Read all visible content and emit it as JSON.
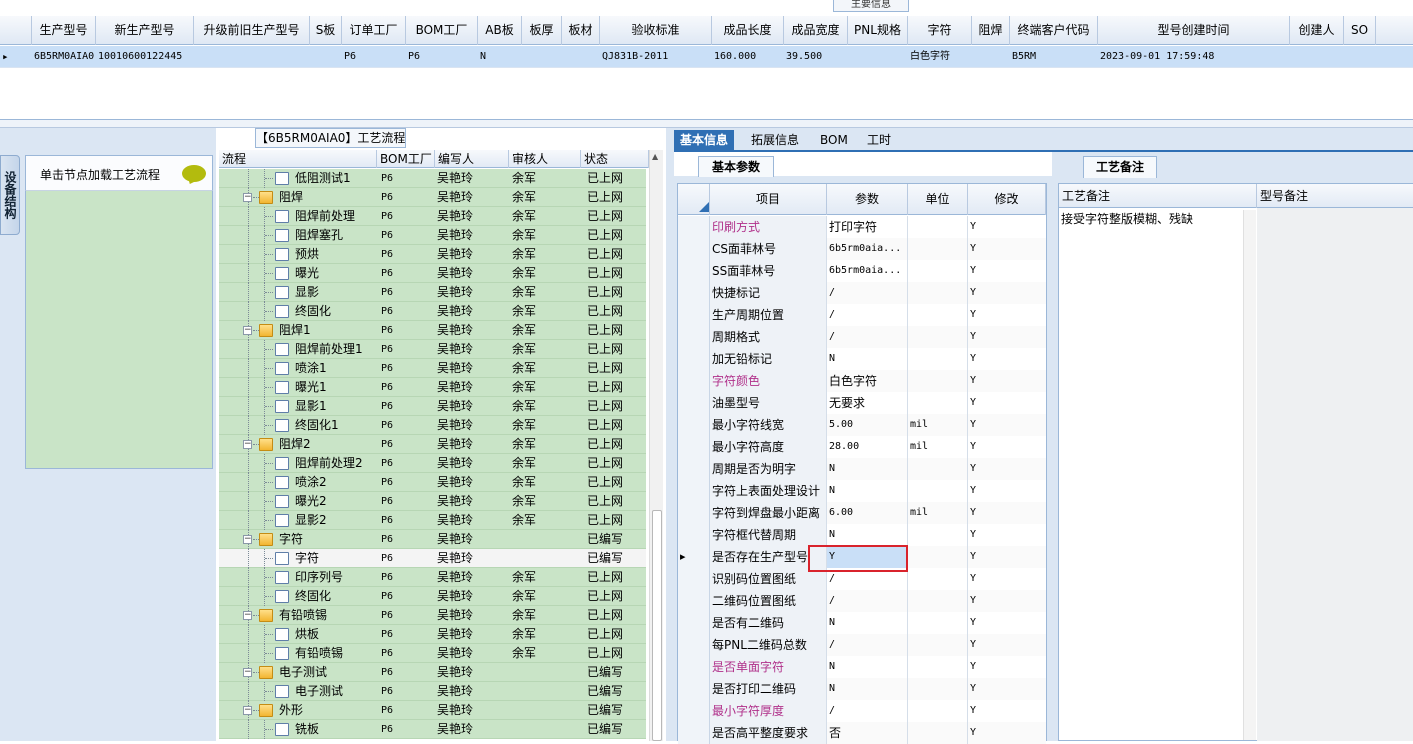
{
  "top_grid": {
    "group_label": "主要信息",
    "columns": [
      "生产型号",
      "新生产型号",
      "升级前旧生产型号",
      "S板",
      "订单工厂",
      "BOM工厂",
      "AB板",
      "板厚",
      "板材",
      "验收标准",
      "成品长度",
      "成品宽度",
      "PNL规格",
      "字符",
      "阻焊",
      "终端客户代码",
      "型号创建时间",
      "创建人",
      "SO"
    ],
    "row": [
      "6B5RM0AIA0",
      "10010600122445",
      "",
      "",
      "P6",
      "P6",
      "N",
      "",
      "",
      "QJ831B-2011",
      "160.000",
      "39.500",
      "",
      "白色字符",
      "",
      "B5RM",
      "2023-09-01 17:59:48",
      "",
      ""
    ]
  },
  "left_nav": {
    "tab_label": "设备结构",
    "hint": "单击节点加载工艺流程"
  },
  "process_tree": {
    "title": "【6B5RM0AIA0】工艺流程",
    "columns": [
      "流程",
      "BOM工厂",
      "编写人",
      "审核人",
      "状态"
    ],
    "rows": [
      {
        "name": "低阻测试1",
        "level": 1,
        "type": "file",
        "bom": "P6",
        "writer": "吴艳玲",
        "reviewer": "余军",
        "status": "已上网"
      },
      {
        "name": "阻焊",
        "level": 0,
        "type": "folder",
        "bom": "P6",
        "writer": "吴艳玲",
        "reviewer": "余军",
        "status": "已上网"
      },
      {
        "name": "阻焊前处理",
        "level": 1,
        "type": "file",
        "bom": "P6",
        "writer": "吴艳玲",
        "reviewer": "余军",
        "status": "已上网"
      },
      {
        "name": "阻焊塞孔",
        "level": 1,
        "type": "file",
        "bom": "P6",
        "writer": "吴艳玲",
        "reviewer": "余军",
        "status": "已上网"
      },
      {
        "name": "预烘",
        "level": 1,
        "type": "file",
        "bom": "P6",
        "writer": "吴艳玲",
        "reviewer": "余军",
        "status": "已上网"
      },
      {
        "name": "曝光",
        "level": 1,
        "type": "file",
        "bom": "P6",
        "writer": "吴艳玲",
        "reviewer": "余军",
        "status": "已上网"
      },
      {
        "name": "显影",
        "level": 1,
        "type": "file",
        "bom": "P6",
        "writer": "吴艳玲",
        "reviewer": "余军",
        "status": "已上网"
      },
      {
        "name": "终固化",
        "level": 1,
        "type": "file",
        "bom": "P6",
        "writer": "吴艳玲",
        "reviewer": "余军",
        "status": "已上网"
      },
      {
        "name": "阻焊1",
        "level": 0,
        "type": "folder",
        "bom": "P6",
        "writer": "吴艳玲",
        "reviewer": "余军",
        "status": "已上网"
      },
      {
        "name": "阻焊前处理1",
        "level": 1,
        "type": "file",
        "bom": "P6",
        "writer": "吴艳玲",
        "reviewer": "余军",
        "status": "已上网"
      },
      {
        "name": "喷涂1",
        "level": 1,
        "type": "file",
        "bom": "P6",
        "writer": "吴艳玲",
        "reviewer": "余军",
        "status": "已上网"
      },
      {
        "name": "曝光1",
        "level": 1,
        "type": "file",
        "bom": "P6",
        "writer": "吴艳玲",
        "reviewer": "余军",
        "status": "已上网"
      },
      {
        "name": "显影1",
        "level": 1,
        "type": "file",
        "bom": "P6",
        "writer": "吴艳玲",
        "reviewer": "余军",
        "status": "已上网"
      },
      {
        "name": "终固化1",
        "level": 1,
        "type": "file",
        "bom": "P6",
        "writer": "吴艳玲",
        "reviewer": "余军",
        "status": "已上网"
      },
      {
        "name": "阻焊2",
        "level": 0,
        "type": "folder",
        "bom": "P6",
        "writer": "吴艳玲",
        "reviewer": "余军",
        "status": "已上网"
      },
      {
        "name": "阻焊前处理2",
        "level": 1,
        "type": "file",
        "bom": "P6",
        "writer": "吴艳玲",
        "reviewer": "余军",
        "status": "已上网"
      },
      {
        "name": "喷涂2",
        "level": 1,
        "type": "file",
        "bom": "P6",
        "writer": "吴艳玲",
        "reviewer": "余军",
        "status": "已上网"
      },
      {
        "name": "曝光2",
        "level": 1,
        "type": "file",
        "bom": "P6",
        "writer": "吴艳玲",
        "reviewer": "余军",
        "status": "已上网"
      },
      {
        "name": "显影2",
        "level": 1,
        "type": "file",
        "bom": "P6",
        "writer": "吴艳玲",
        "reviewer": "余军",
        "status": "已上网"
      },
      {
        "name": "字符",
        "level": 0,
        "type": "folder",
        "bom": "P6",
        "writer": "吴艳玲",
        "reviewer": "",
        "status": "已编写"
      },
      {
        "name": "字符",
        "level": 1,
        "type": "file",
        "bom": "P6",
        "writer": "吴艳玲",
        "reviewer": "",
        "status": "已编写",
        "selected": true
      },
      {
        "name": "印序列号",
        "level": 1,
        "type": "file",
        "bom": "P6",
        "writer": "吴艳玲",
        "reviewer": "余军",
        "status": "已上网"
      },
      {
        "name": "终固化",
        "level": 1,
        "type": "file",
        "bom": "P6",
        "writer": "吴艳玲",
        "reviewer": "余军",
        "status": "已上网"
      },
      {
        "name": "有铅喷锡",
        "level": 0,
        "type": "folder",
        "bom": "P6",
        "writer": "吴艳玲",
        "reviewer": "余军",
        "status": "已上网"
      },
      {
        "name": "烘板",
        "level": 1,
        "type": "file",
        "bom": "P6",
        "writer": "吴艳玲",
        "reviewer": "余军",
        "status": "已上网"
      },
      {
        "name": "有铅喷锡",
        "level": 1,
        "type": "file",
        "bom": "P6",
        "writer": "吴艳玲",
        "reviewer": "余军",
        "status": "已上网"
      },
      {
        "name": "电子测试",
        "level": 0,
        "type": "folder",
        "bom": "P6",
        "writer": "吴艳玲",
        "reviewer": "",
        "status": "已编写"
      },
      {
        "name": "电子测试",
        "level": 1,
        "type": "file",
        "bom": "P6",
        "writer": "吴艳玲",
        "reviewer": "",
        "status": "已编写"
      },
      {
        "name": "外形",
        "level": 0,
        "type": "folder",
        "bom": "P6",
        "writer": "吴艳玲",
        "reviewer": "",
        "status": "已编写"
      },
      {
        "name": "铣板",
        "level": 1,
        "type": "file",
        "bom": "P6",
        "writer": "吴艳玲",
        "reviewer": "",
        "status": "已编写"
      }
    ]
  },
  "right_tabs": [
    "基本信息",
    "拓展信息",
    "BOM",
    "工时"
  ],
  "basic_params": {
    "title": "基本参数",
    "columns": [
      "项目",
      "参数",
      "单位",
      "修改"
    ],
    "rows": [
      {
        "name": "印刷方式",
        "value": "打印字符",
        "unit": "",
        "mod": "Y",
        "pink": true
      },
      {
        "name": "CS面菲林号",
        "value": "6b5rm0aia...",
        "unit": "",
        "mod": "Y"
      },
      {
        "name": "SS面菲林号",
        "value": "6b5rm0aia...",
        "unit": "",
        "mod": "Y"
      },
      {
        "name": "快捷标记",
        "value": "/",
        "unit": "",
        "mod": "Y"
      },
      {
        "name": "生产周期位置",
        "value": "/",
        "unit": "",
        "mod": "Y"
      },
      {
        "name": "周期格式",
        "value": "/",
        "unit": "",
        "mod": "Y"
      },
      {
        "name": "加无铅标记",
        "value": "N",
        "unit": "",
        "mod": "Y"
      },
      {
        "name": "字符颜色",
        "value": "白色字符",
        "unit": "",
        "mod": "Y",
        "pink": true
      },
      {
        "name": "油墨型号",
        "value": "无要求",
        "unit": "",
        "mod": "Y"
      },
      {
        "name": "最小字符线宽",
        "value": "5.00",
        "unit": "mil",
        "mod": "Y"
      },
      {
        "name": "最小字符高度",
        "value": "28.00",
        "unit": "mil",
        "mod": "Y"
      },
      {
        "name": "周期是否为明字",
        "value": "N",
        "unit": "",
        "mod": "Y"
      },
      {
        "name": "字符上表面处理设计",
        "value": "N",
        "unit": "",
        "mod": "Y"
      },
      {
        "name": "字符到焊盘最小距离",
        "value": "6.00",
        "unit": "mil",
        "mod": "Y"
      },
      {
        "name": "字符框代替周期",
        "value": "N",
        "unit": "",
        "mod": "Y"
      },
      {
        "name": "是否存在生产型号",
        "value": "Y",
        "unit": "",
        "mod": "Y",
        "current": true
      },
      {
        "name": "识别码位置图纸",
        "value": "/",
        "unit": "",
        "mod": "Y"
      },
      {
        "name": "二维码位置图纸",
        "value": "/",
        "unit": "",
        "mod": "Y"
      },
      {
        "name": "是否有二维码",
        "value": "N",
        "unit": "",
        "mod": "Y"
      },
      {
        "name": "每PNL二维码总数",
        "value": "/",
        "unit": "",
        "mod": "Y"
      },
      {
        "name": "是否单面字符",
        "value": "N",
        "unit": "",
        "mod": "Y",
        "pink": true
      },
      {
        "name": "是否打印二维码",
        "value": "N",
        "unit": "",
        "mod": "Y"
      },
      {
        "name": "最小字符厚度",
        "value": "/",
        "unit": "",
        "mod": "Y",
        "pink": true
      },
      {
        "name": "是否高平整度要求",
        "value": "否",
        "unit": "",
        "mod": "Y"
      }
    ]
  },
  "process_notes": {
    "title": "工艺备注",
    "columns": [
      "工艺备注",
      "型号备注"
    ],
    "text": "接受字符整版模糊、残缺"
  }
}
